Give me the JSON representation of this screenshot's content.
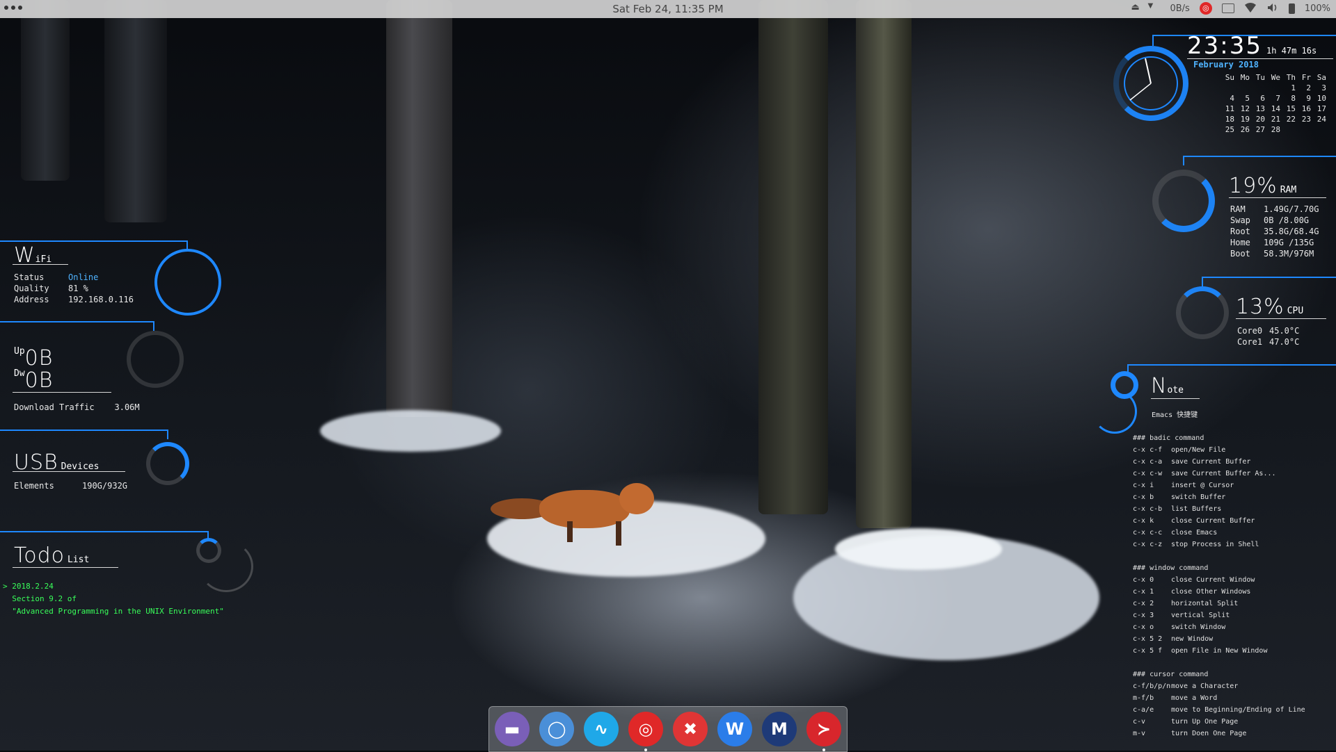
{
  "topbar": {
    "datetime": "Sat Feb 24, 11:35 PM",
    "net_speed": "0B/s",
    "battery": "100%"
  },
  "clock": {
    "time": "23:35",
    "uptime": "1h 47m 16s"
  },
  "calendar": {
    "month": "February 2018",
    "weekdays": [
      "Su",
      "Mo",
      "Tu",
      "We",
      "Th",
      "Fr",
      "Sa"
    ],
    "weeks": [
      [
        "",
        "",
        "",
        "",
        "1",
        "2",
        "3"
      ],
      [
        "4",
        "5",
        "6",
        "7",
        "8",
        "9",
        "10"
      ],
      [
        "11",
        "12",
        "13",
        "14",
        "15",
        "16",
        "17"
      ],
      [
        "18",
        "19",
        "20",
        "21",
        "22",
        "23",
        "24"
      ],
      [
        "25",
        "26",
        "27",
        "28",
        "",
        "",
        ""
      ]
    ]
  },
  "ram": {
    "percent": "19%",
    "label": "RAM",
    "rows": [
      {
        "k": "RAM",
        "v": "1.49G/7.70G"
      },
      {
        "k": "Swap",
        "v": "0B  /8.00G"
      },
      {
        "k": "Root",
        "v": "35.8G/68.4G"
      },
      {
        "k": "Home",
        "v": "109G /135G"
      },
      {
        "k": "Boot",
        "v": "58.3M/976M"
      }
    ]
  },
  "cpu": {
    "percent": "13%",
    "label": "CPU",
    "rows": [
      {
        "k": "Core0",
        "v": "45.0°C"
      },
      {
        "k": "Core1",
        "v": "47.0°C"
      }
    ]
  },
  "wifi": {
    "title_big": "W",
    "title_small": "iFi",
    "rows": [
      {
        "k": "Status",
        "v": "Online"
      },
      {
        "k": "Quality",
        "v": "81   %"
      },
      {
        "k": "Address",
        "v": "192.168.0.116"
      }
    ]
  },
  "traffic": {
    "up_label": "Up",
    "up_value": "0B",
    "down_label": "Dw",
    "down_value": "0B",
    "download_label": "Download Traffic",
    "download_value": "3.06M"
  },
  "usb": {
    "title_big": "USB",
    "title_small": "Devices",
    "elements_label": "Elements",
    "elements_value": "190G/932G"
  },
  "todo": {
    "title_big": "Todo",
    "title_small": "List",
    "lines": [
      "> 2018.2.24",
      "  Section 9.2 of",
      "  \"Advanced Programming in the UNIX Environment\""
    ]
  },
  "note": {
    "title_big": "N",
    "title_small": "ote",
    "subtitle": "Emacs 快捷键",
    "sections": [
      {
        "header": "### badic command",
        "rows": [
          [
            "c-x c-f",
            "open/New File"
          ],
          [
            "c-x c-a",
            "save Current Buffer"
          ],
          [
            "c-x c-w",
            "save Current Buffer As..."
          ],
          [
            "c-x i",
            "insert @ Cursor"
          ],
          [
            "c-x b",
            "switch Buffer"
          ],
          [
            "c-x c-b",
            "list Buffers"
          ],
          [
            "c-x k",
            "close Current Buffer"
          ],
          [
            "c-x c-c",
            "close Emacs"
          ],
          [
            "c-x c-z",
            "stop Process in Shell"
          ]
        ]
      },
      {
        "header": "### window command",
        "rows": [
          [
            "c-x 0",
            "close Current Window"
          ],
          [
            "c-x 1",
            "close Other Windows"
          ],
          [
            "c-x 2",
            "horizontal Split"
          ],
          [
            "c-x 3",
            "vertical Split"
          ],
          [
            "c-x o",
            "switch Window"
          ],
          [
            "c-x 5 2",
            "new Window"
          ],
          [
            "c-x 5 f",
            "open File in New Window"
          ]
        ]
      },
      {
        "header": "### cursor command",
        "rows": [
          [
            "c-f/b/p/n",
            "move a Character"
          ],
          [
            "m-f/b",
            "move a Word"
          ],
          [
            "c-a/e",
            "move to Beginning/Ending of Line"
          ],
          [
            "c-v",
            "turn Up One Page"
          ],
          [
            "m-v",
            "turn Doen One Page"
          ]
        ]
      }
    ]
  },
  "dock": {
    "items": [
      {
        "name": "files-icon",
        "color": "#7a5fb8",
        "glyph": "▬"
      },
      {
        "name": "browser-icon",
        "color": "#4a8fd8",
        "glyph": "◯"
      },
      {
        "name": "monitor-icon",
        "color": "#1fa8e8",
        "glyph": "∿"
      },
      {
        "name": "music-icon",
        "color": "#e02828",
        "glyph": "◎"
      },
      {
        "name": "xmind-icon",
        "color": "#e03535",
        "glyph": "✖"
      },
      {
        "name": "wps-writer-icon",
        "color": "#2b7de9",
        "glyph": "W"
      },
      {
        "name": "mail-icon",
        "color": "#1e3a78",
        "glyph": "M"
      },
      {
        "name": "terminal-icon",
        "color": "#d8262c",
        "glyph": "≻"
      }
    ]
  },
  "accent": "#1e88ff"
}
